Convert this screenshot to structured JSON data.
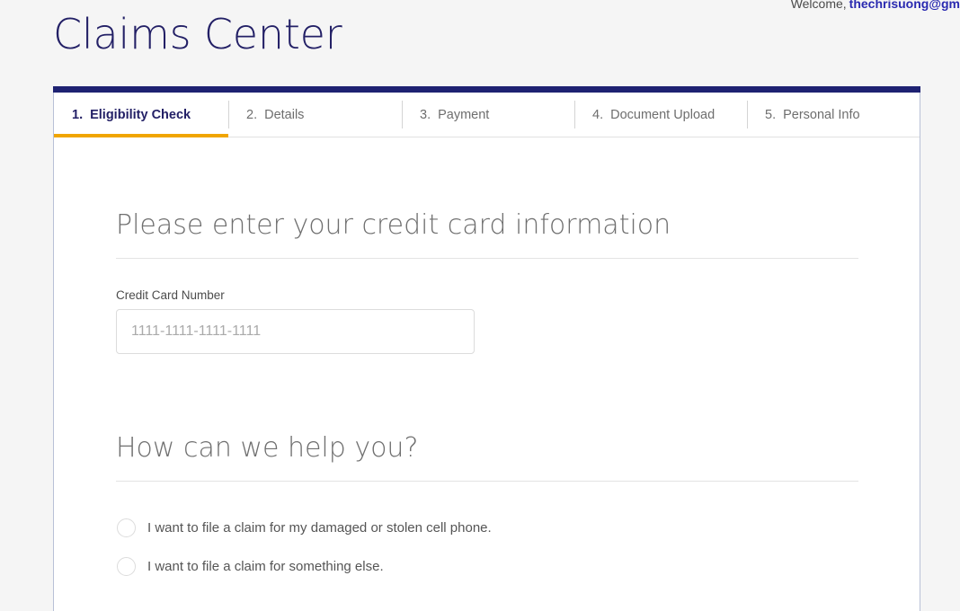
{
  "topbar": {
    "welcome_text": "Welcome,",
    "welcome_email": "thechrisuong@gm"
  },
  "header": {
    "title": "Claims Center"
  },
  "tabs": [
    {
      "number": "1.",
      "label": "Eligibility Check",
      "active": true
    },
    {
      "number": "2.",
      "label": "Details",
      "active": false
    },
    {
      "number": "3.",
      "label": "Payment",
      "active": false
    },
    {
      "number": "4.",
      "label": "Document Upload",
      "active": false
    },
    {
      "number": "5.",
      "label": "Personal Info",
      "active": false
    }
  ],
  "payment_section": {
    "heading": "Please enter your credit card information",
    "card_number": {
      "label": "Credit Card Number",
      "value": "",
      "placeholder": "1111-1111-1111-1111"
    }
  },
  "help_section": {
    "heading": "How can we help you?",
    "options": [
      {
        "label": "I want to file a claim for my damaged or stolen cell phone.",
        "selected": false
      },
      {
        "label": "I want to file a claim for something else.",
        "selected": false
      }
    ]
  },
  "colors": {
    "brand_navy": "#232066",
    "topbar_navy": "#1e2272",
    "accent_gold": "#f0a500",
    "link_blue": "#2a2ab0",
    "page_bg": "#f5f5f5",
    "card_border": "#b9c0d6"
  }
}
